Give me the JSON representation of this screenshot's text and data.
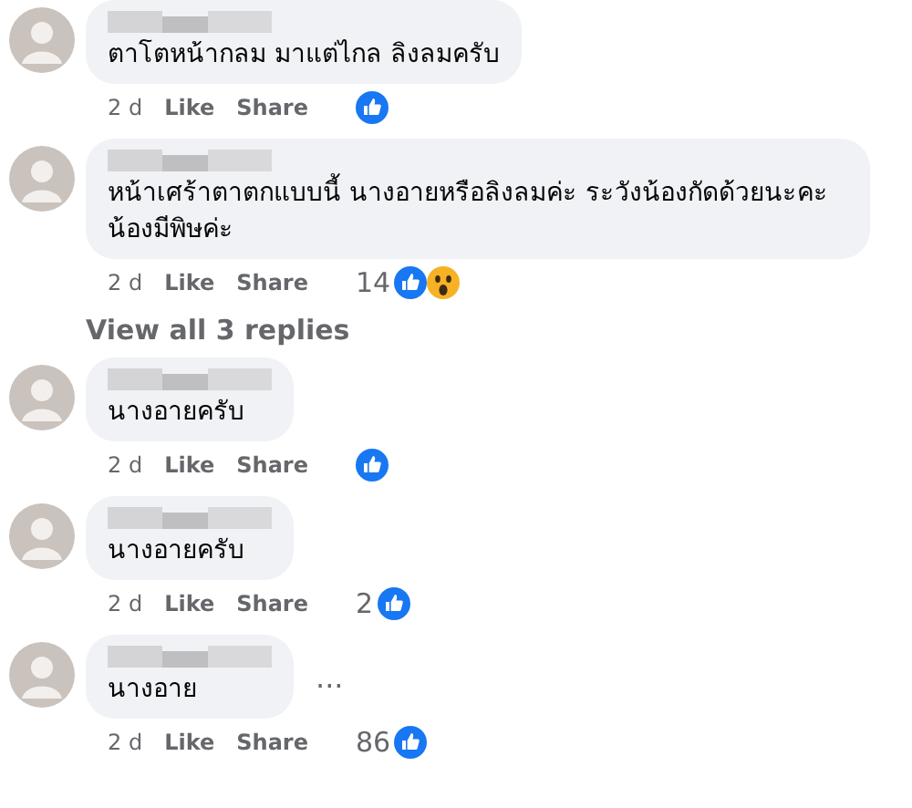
{
  "items": [
    {
      "kind": "comment",
      "text": "ตาโตหน้ากลม มาแต่ไกล ลิงลมครับ",
      "time": "2 d",
      "like": "Like",
      "share": "Share",
      "reactions": [
        {
          "kind": "like"
        }
      ]
    },
    {
      "kind": "comment",
      "text": "หน้าเศร้าตาตกแบบนี้ นางอายหรือลิงลมค่ะ ระวังน้องกัดด้วยนะคะ น้องมีพิษค่ะ",
      "time": "2 d",
      "like": "Like",
      "share": "Share",
      "count": "14",
      "reactions": [
        {
          "kind": "like"
        },
        {
          "kind": "wow"
        }
      ]
    },
    {
      "kind": "view_replies",
      "text": "View all 3 replies"
    },
    {
      "kind": "comment",
      "text": "นางอายครับ",
      "time": "2 d",
      "like": "Like",
      "share": "Share",
      "reactions": [
        {
          "kind": "like"
        }
      ]
    },
    {
      "kind": "comment",
      "text": "นางอายครับ",
      "time": "2 d",
      "like": "Like",
      "share": "Share",
      "count": "2",
      "reactions": [
        {
          "kind": "like"
        }
      ]
    },
    {
      "kind": "comment",
      "text": "นางอาย",
      "time": "2 d",
      "like": "Like",
      "share": "Share",
      "count": "86",
      "reactions": [
        {
          "kind": "like"
        }
      ],
      "more": "..."
    }
  ]
}
